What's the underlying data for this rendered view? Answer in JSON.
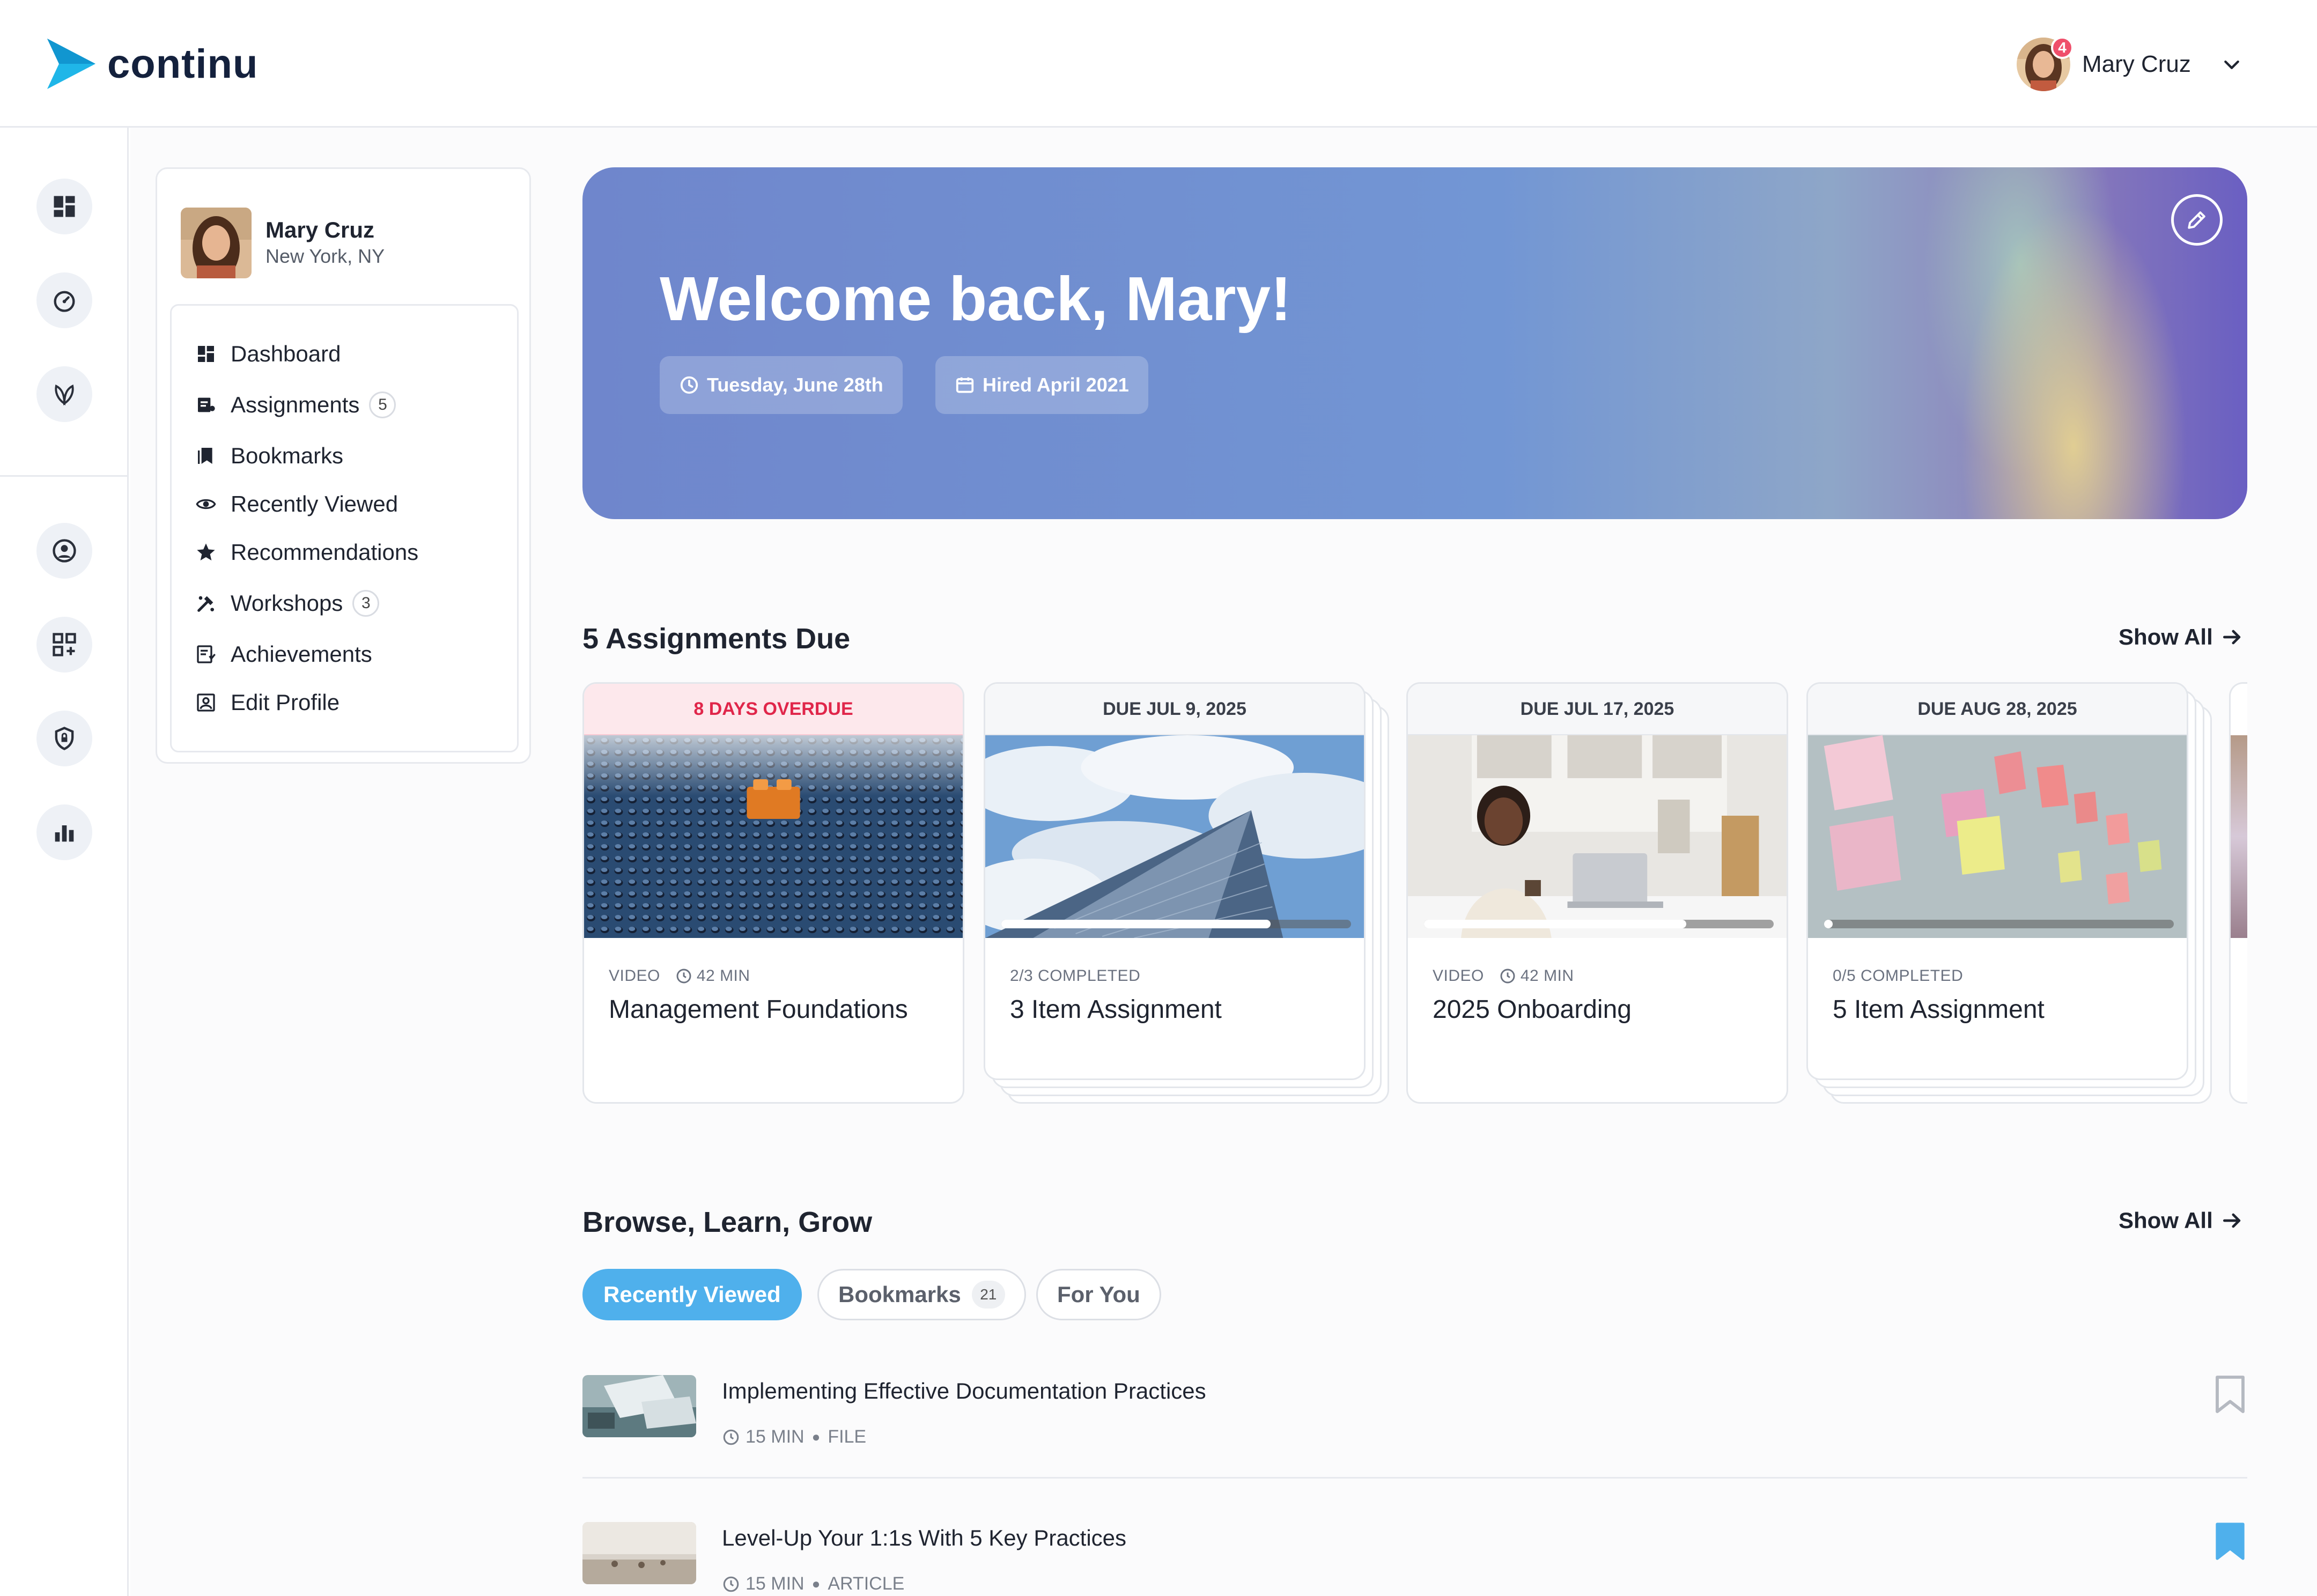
{
  "app": {
    "logo_text": "continu",
    "brand_color": "#1fb6e8"
  },
  "header": {
    "user_name": "Mary Cruz",
    "notification_count": "4"
  },
  "rail": {
    "icons": [
      "dashboard-icon",
      "gauge-icon",
      "leaf-icon",
      "user-circle-icon",
      "apps-add-icon",
      "shield-icon",
      "bar-chart-icon"
    ]
  },
  "profile": {
    "name": "Mary Cruz",
    "location": "New York, NY"
  },
  "nav": {
    "items": [
      {
        "label": "Dashboard",
        "icon": "dashboard-icon"
      },
      {
        "label": "Assignments",
        "icon": "assignment-icon",
        "badge": "5"
      },
      {
        "label": "Bookmarks",
        "icon": "bookmarks-icon"
      },
      {
        "label": "Recently Viewed",
        "icon": "eye-icon"
      },
      {
        "label": "Recommendations",
        "icon": "star-icon"
      },
      {
        "label": "Workshops",
        "icon": "tools-icon",
        "badge": "3"
      },
      {
        "label": "Achievements",
        "icon": "achievement-icon"
      },
      {
        "label": "Edit Profile",
        "icon": "profile-icon"
      }
    ]
  },
  "hero": {
    "title": "Welcome back, Mary!",
    "date_pill": "Tuesday, June 28th",
    "hired_pill": "Hired April 2021"
  },
  "assignments": {
    "title": "5 Assignments Due",
    "show_all": "Show All",
    "cards": [
      {
        "due": "8 DAYS OVERDUE",
        "meta_type": "VIDEO",
        "meta_duration": "42 MIN",
        "title": "Management Foundations",
        "overdue": true
      },
      {
        "due": "DUE JUL 9, 2025",
        "meta_type": "2/3 COMPLETED",
        "title": "3 Item Assignment",
        "progress": 0.77
      },
      {
        "due": "DUE JUL 17, 2025",
        "meta_type": "VIDEO",
        "meta_duration": "42 MIN",
        "title": "2025 Onboarding",
        "progress": 0.75
      },
      {
        "due": "DUE AUG 28, 2025",
        "meta_type": "0/5 COMPLETED",
        "title": "5 Item Assignment",
        "progress": 0.02
      }
    ]
  },
  "browse": {
    "title": "Browse, Learn, Grow",
    "show_all": "Show All",
    "tabs": [
      {
        "label": "Recently Viewed",
        "active": true
      },
      {
        "label": "Bookmarks",
        "badge": "21"
      },
      {
        "label": "For You"
      }
    ],
    "items": [
      {
        "title": "Implementing Effective Documentation Practices",
        "duration": "15 MIN",
        "type": "FILE",
        "bookmarked": false
      },
      {
        "title": "Level-Up Your 1:1s With 5 Key Practices",
        "duration": "15 MIN",
        "type": "ARTICLE",
        "bookmarked": true
      }
    ]
  }
}
